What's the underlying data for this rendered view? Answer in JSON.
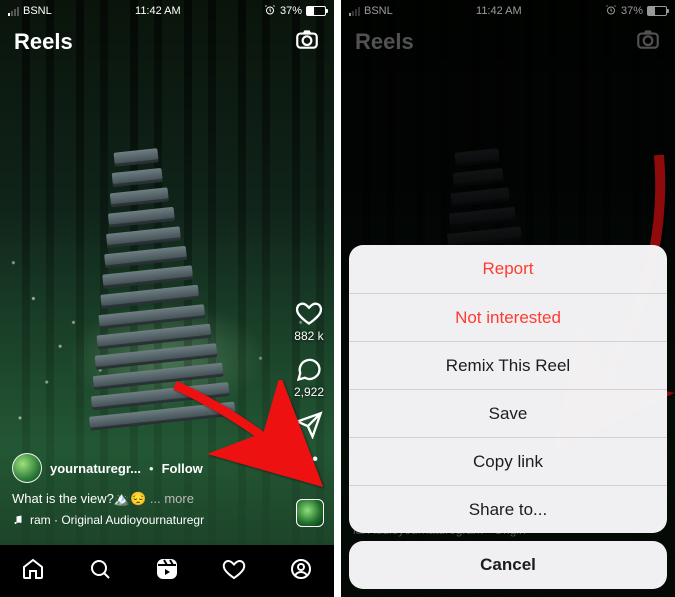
{
  "status": {
    "carrier": "BSNL",
    "time": "11:42 AM",
    "battery_pct": "37%",
    "alarm_icon": "alarm-icon"
  },
  "header": {
    "title": "Reels"
  },
  "rail": {
    "like_count": "882 k",
    "comment_count": "2,922"
  },
  "meta": {
    "username": "yournaturegr...",
    "follow": "Follow",
    "caption_text": "What is the view?",
    "caption_emoji": "🏔️😔",
    "more": "more",
    "audio": "ram · Original Audioyournaturegr"
  },
  "right_screen_audio": "ial Audioyournaturegram · Origin",
  "sheet": {
    "report": "Report",
    "not_interested": "Not interested",
    "remix": "Remix This Reel",
    "save": "Save",
    "copy_link": "Copy link",
    "share_to": "Share to...",
    "cancel": "Cancel"
  }
}
